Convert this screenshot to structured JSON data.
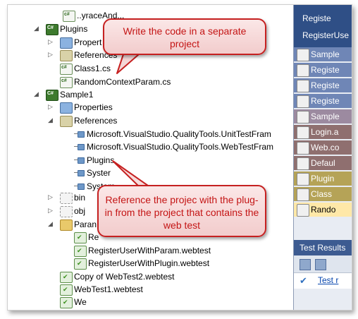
{
  "tree": {
    "items": [
      {
        "label": "..yraceAnd...",
        "icon": "cs-file-icon"
      },
      {
        "label": "Plugins",
        "icon": "csharp-project-icon"
      },
      {
        "label": "Propert",
        "icon": "properties-icon"
      },
      {
        "label": "References",
        "icon": "references-icon"
      },
      {
        "label": "Class1.cs",
        "icon": "cs-file-icon"
      },
      {
        "label": "RandomContextParam.cs",
        "icon": "cs-file-icon"
      },
      {
        "label": "Sample1",
        "icon": "csharp-project-icon"
      },
      {
        "label": "Properties",
        "icon": "properties-icon"
      },
      {
        "label": "References",
        "icon": "references-icon"
      },
      {
        "label": "Microsoft.VisualStudio.QualityTools.UnitTestFram",
        "icon": "reference-icon"
      },
      {
        "label": "Microsoft.VisualStudio.QualityTools.WebTestFram",
        "icon": "reference-icon"
      },
      {
        "label": "Plugins",
        "icon": "reference-icon"
      },
      {
        "label": "Syster",
        "icon": "reference-icon"
      },
      {
        "label": "System",
        "icon": "reference-icon"
      },
      {
        "label": "bin",
        "icon": "hidden-folder-icon"
      },
      {
        "label": "obj",
        "icon": "hidden-folder-icon"
      },
      {
        "label": "Paran",
        "icon": "folder-open-icon"
      },
      {
        "label": "Re",
        "icon": "webtest-icon"
      },
      {
        "label": "RegisterUserWithParam.webtest",
        "icon": "webtest-icon"
      },
      {
        "label": "RegisterUserWithPlugin.webtest",
        "icon": "webtest-icon"
      },
      {
        "label": "Copy of WebTest2.webtest",
        "icon": "webtest-icon"
      },
      {
        "label": "WebTest1.webtest",
        "icon": "webtest-icon"
      },
      {
        "label": "We",
        "icon": "webtest-icon"
      }
    ]
  },
  "right_panel": {
    "header_line1": "Registe",
    "header_line2": "RegisterUse",
    "tabs": [
      {
        "label": "Sample",
        "color": "#6f86b6"
      },
      {
        "label": "Registe",
        "color": "#6f86b6"
      },
      {
        "label": "Registe",
        "color": "#6f86b6"
      },
      {
        "label": "Registe",
        "color": "#6f86b6"
      },
      {
        "label": "Sample",
        "color": "#9c8aa0"
      },
      {
        "label": "Login.a",
        "color": "#8f6f6f"
      },
      {
        "label": "Web.co",
        "color": "#8f6f6f"
      },
      {
        "label": "Defaul",
        "color": "#8f6f6f"
      },
      {
        "label": "Plugin",
        "color": "#b5a357"
      },
      {
        "label": "Class",
        "color": "#b5a357"
      },
      {
        "label": "Rando",
        "color": "#ffe8a8"
      }
    ],
    "test_results": {
      "title": "Test Results",
      "row_label": "Test r"
    }
  },
  "callouts": {
    "top": "Write the code in a separate project",
    "bottom": "Reference the projec with the plug-in from the project that contains the web test"
  }
}
